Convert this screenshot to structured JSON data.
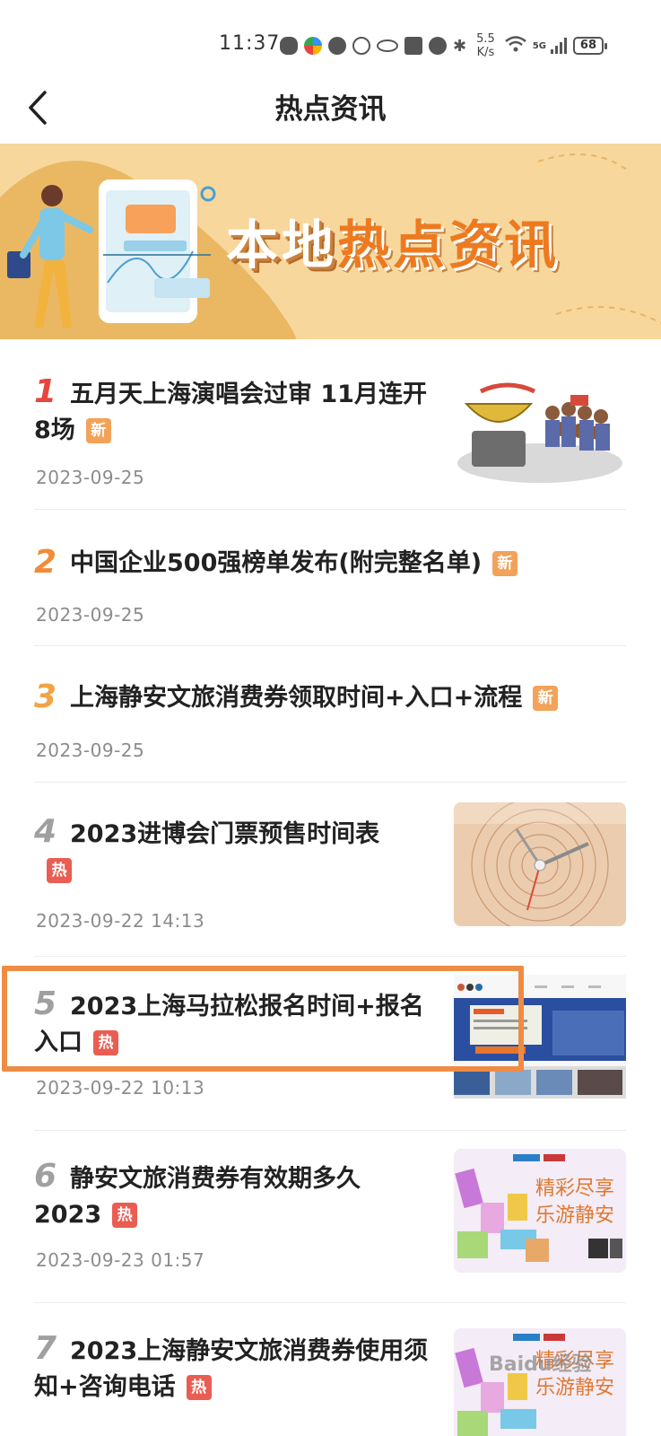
{
  "status_bar": {
    "time": "11:37",
    "net_speed_value": "5.5",
    "net_speed_unit": "K/s",
    "network_type": "5G",
    "battery": "68",
    "icons": [
      "wechat-icon",
      "app-icon",
      "audio-icon",
      "vpn-icon",
      "eye-icon",
      "nfc-icon",
      "alarm-icon",
      "bluetooth-icon",
      "wifi-icon",
      "signal-icon",
      "battery-icon"
    ]
  },
  "nav": {
    "title": "热点资讯",
    "back_icon": "chevron-left-icon"
  },
  "banner": {
    "text_white": "本地",
    "text_orange": "热点资讯",
    "colors": {
      "background": "#f5d08d",
      "accent": "#ee7a1f"
    }
  },
  "news": [
    {
      "rank": "1",
      "title": "五月天上海演唱会过审 11月连开8场",
      "badge": "新",
      "date": "2023-09-25",
      "has_thumb": true,
      "thumb": "cartoon-illustration"
    },
    {
      "rank": "2",
      "title": "中国企业500强榜单发布(附完整名单)",
      "badge": "新",
      "date": "2023-09-25",
      "has_thumb": false
    },
    {
      "rank": "3",
      "title": "上海静安文旅消费券领取时间+入口+流程",
      "badge": "新",
      "date": "2023-09-25",
      "has_thumb": false
    },
    {
      "rank": "4",
      "title": "2023进博会门票预售时间表",
      "badge": "热",
      "date": "2023-09-22 14:13",
      "has_thumb": true,
      "thumb": "clock-photo"
    },
    {
      "rank": "5",
      "title": "2023上海马拉松报名时间+报名入口",
      "badge": "热",
      "date": "2023-09-22 10:13",
      "has_thumb": true,
      "thumb": "website-screenshot"
    },
    {
      "rank": "6",
      "title": "静安文旅消费券有效期多久2023",
      "badge": "热",
      "date": "2023-09-23 01:57",
      "has_thumb": true,
      "thumb": "jingan-poster",
      "thumb_text": "精彩尽享\n乐游静安"
    },
    {
      "rank": "7",
      "title": "2023上海静安文旅消费券使用须知+咨询电话",
      "badge": "热",
      "date": "",
      "has_thumb": true,
      "thumb": "jingan-poster",
      "thumb_text": "精彩尽享\n乐游静安"
    }
  ],
  "watermark": "Baidu经验",
  "colors": {
    "rank1": "#e8453c",
    "rank2": "#f08c3a",
    "rank3": "#f2a344",
    "rank_other": "#a0a0a0",
    "badge_new": "#f3a25a",
    "badge_hot": "#ea5d52",
    "highlight": "#ef8c44"
  }
}
